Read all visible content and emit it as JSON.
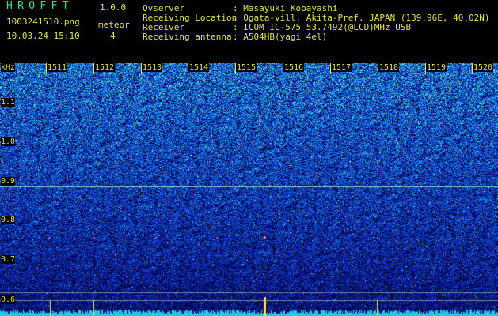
{
  "header": {
    "app_title": "HROFFT",
    "version": "1.0.0",
    "filename": "1003241510.png",
    "datetime": "10.03.24 15:10",
    "meteor_label": "meteor",
    "meteor_count": "4",
    "info": [
      {
        "label": "Ovserver",
        "value": ": Masayuki Kobayashi"
      },
      {
        "label": "Receiving Location",
        "value": ": Ogata-vill. Akita-Pref. JAPAN (139.96E, 40.02N)"
      },
      {
        "label": "Receiver",
        "value": ": ICOM IC-575 53.7492(@LCD)MHz USB"
      },
      {
        "label": "Receiving antenna",
        "value": ": A504HB(yagi 4el)"
      }
    ]
  },
  "axis": {
    "unit": "kHz",
    "freq_ticks": [
      "1.1",
      "1.0",
      "0.9",
      "0.8",
      "0.7",
      "0.6"
    ],
    "minute_ticks": [
      "1511",
      "1512",
      "1513",
      "1514",
      "1515",
      "1516",
      "1517",
      "1518",
      "1519",
      "1520"
    ]
  },
  "colors": {
    "background": "#000000",
    "label_yellow": "#e6e14a",
    "title_green": "#2fe08a",
    "carrier_line": "#8fd0e0",
    "baseline_cyan": "#20c8e8"
  }
}
